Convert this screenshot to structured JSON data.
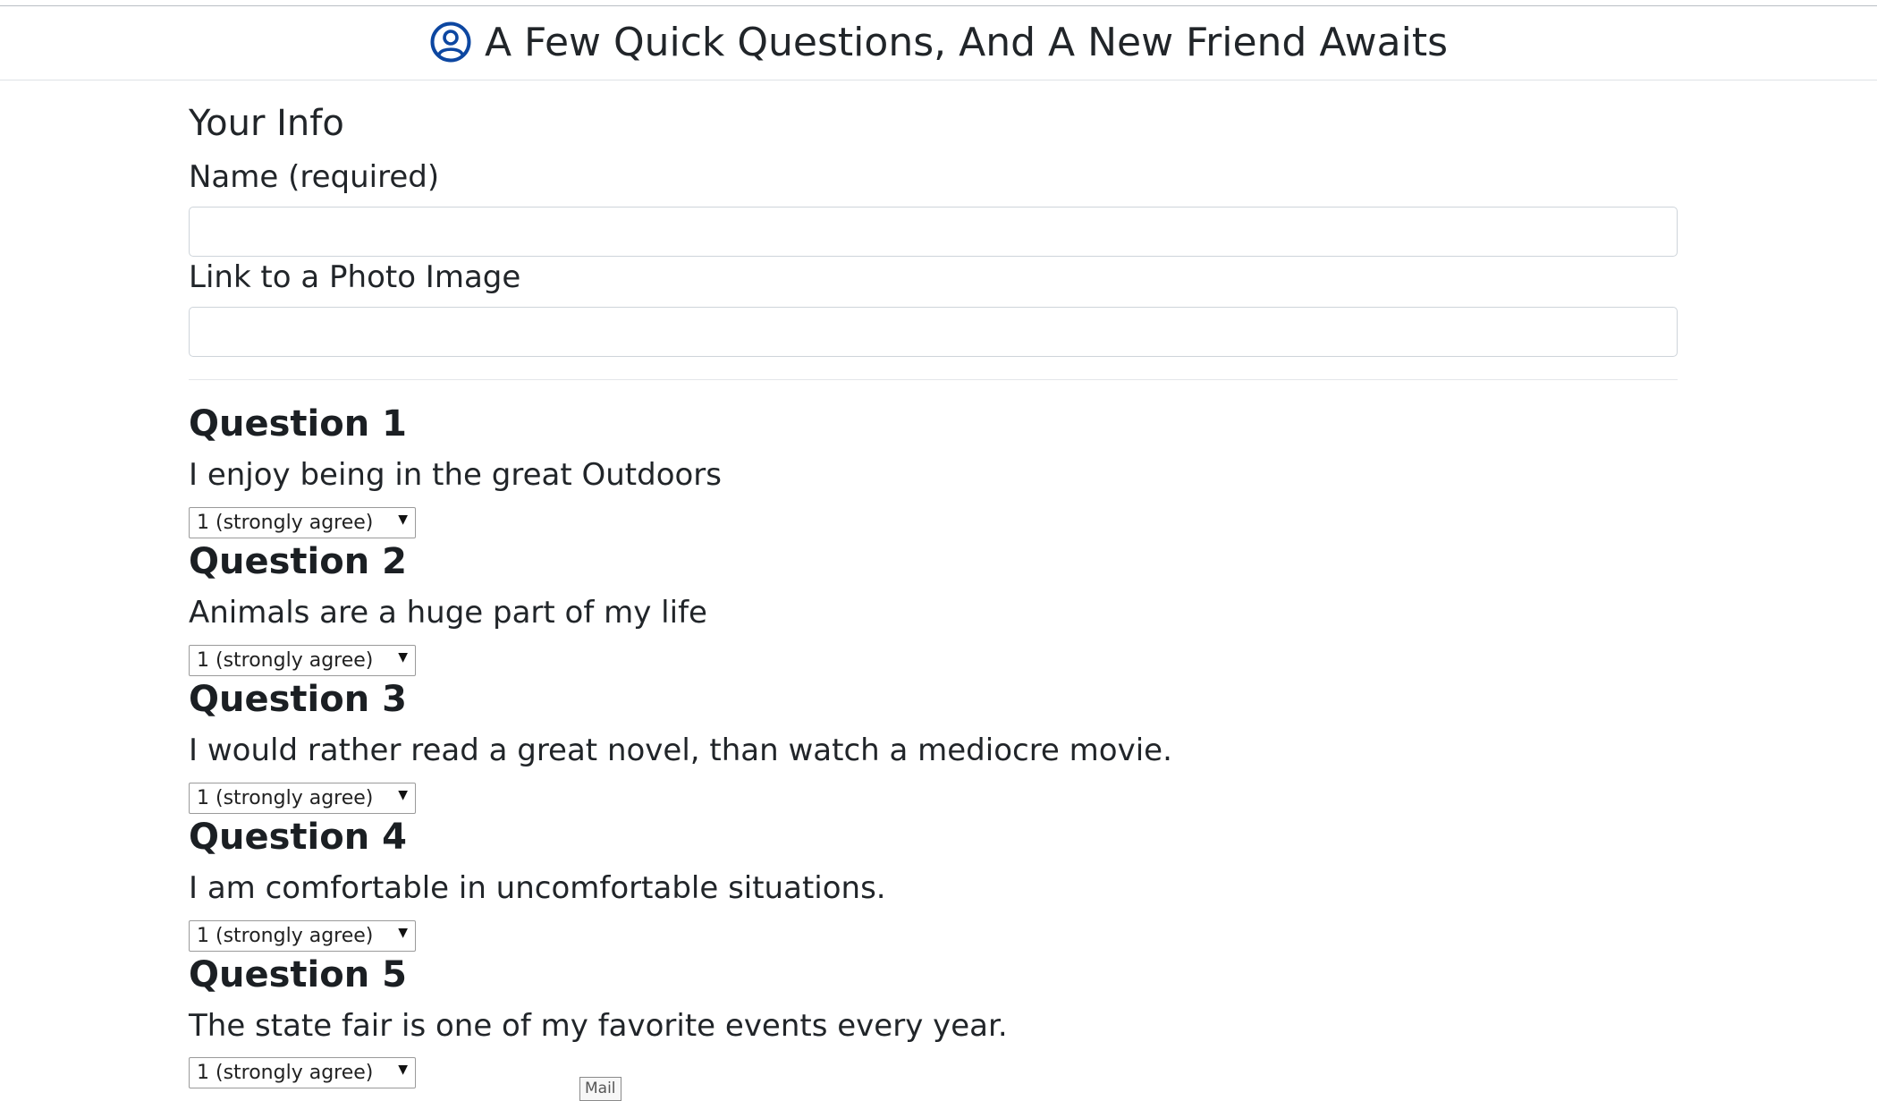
{
  "header": {
    "title": "A Few Quick Questions, And A New Friend Awaits",
    "icon": "user-circle-icon",
    "icon_color": "#0d47a1"
  },
  "your_info": {
    "section_title": "Your Info",
    "name_label": "Name (required)",
    "name_value": "",
    "photo_label": "Link to a Photo Image",
    "photo_value": ""
  },
  "questions": [
    {
      "heading": "Question 1",
      "text": "I enjoy being in the great Outdoors",
      "selected": "1 (strongly agree)"
    },
    {
      "heading": "Question 2",
      "text": "Animals are a huge part of my life",
      "selected": "1 (strongly agree)"
    },
    {
      "heading": "Question 3",
      "text": "I would rather read a great novel, than watch a mediocre movie.",
      "selected": "1 (strongly agree)"
    },
    {
      "heading": "Question 4",
      "text": "I am comfortable in uncomfortable situations.",
      "selected": "1 (strongly agree)"
    },
    {
      "heading": "Question 5",
      "text": "The state fair is one of my favorite events every year.",
      "selected": "1 (strongly agree)"
    }
  ],
  "tooltip": {
    "text": "Mail"
  }
}
